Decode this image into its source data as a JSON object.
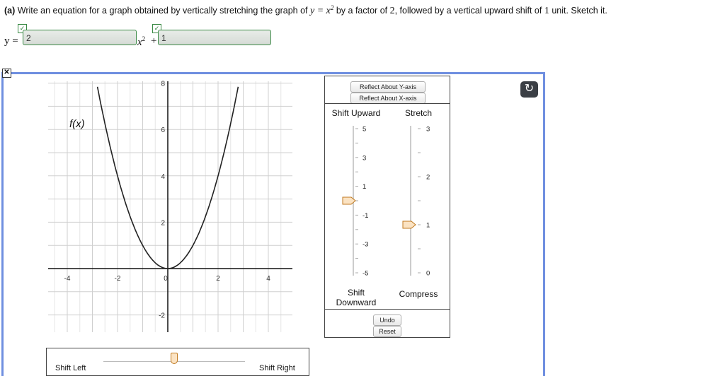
{
  "question": {
    "prefix": "(a)",
    "text_1": "Write an equation for a graph obtained by vertically stretching the graph of",
    "func": "y = x",
    "exp": "2",
    "text_2": "by a factor of",
    "factor": "2",
    "text_3": ", followed by a vertical upward shift of",
    "shift": "1",
    "text_4": "unit. Sketch it."
  },
  "equation": {
    "y_label": "y =",
    "answer_1": "2",
    "x_term": "x",
    "x_exp": "2",
    "plus": "+",
    "answer_2": "1",
    "check_mark": "✓"
  },
  "panel": {
    "close_symbol": "✕",
    "refresh_symbol": "↻"
  },
  "graph": {
    "function_label": "f(x)",
    "x_ticks": [
      "-4",
      "-2",
      "0",
      "2",
      "4"
    ],
    "y_ticks": [
      "8",
      "6",
      "4",
      "2",
      "-2"
    ],
    "function": "y = x^2",
    "grid": true
  },
  "controls": {
    "reflect_y": "Reflect About Y-axis",
    "reflect_x": "Reflect About X-axis",
    "shift_upward": "Shift Upward",
    "stretch": "Stretch",
    "shift_label_1": "Shift",
    "shift_label_2": "Downward",
    "compress": "Compress",
    "undo": "Undo",
    "reset": "Reset",
    "shift_ticks": [
      "5",
      "3",
      "1",
      "-1",
      "-3",
      "-5"
    ],
    "stretch_ticks": [
      "3",
      "2",
      "1",
      "0"
    ],
    "shift_value": 0,
    "stretch_value": 1
  },
  "bottom": {
    "shift_left": "Shift Left",
    "shift_right": "Shift Right"
  }
}
